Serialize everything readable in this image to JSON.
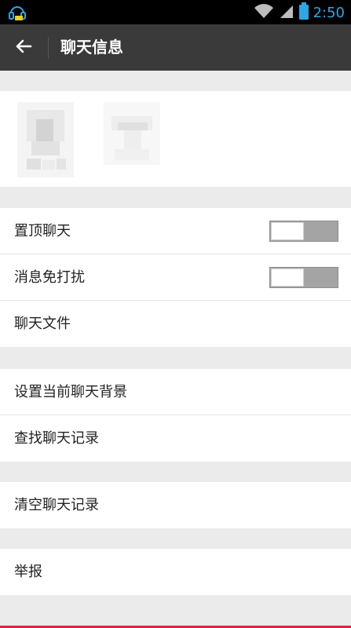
{
  "status_bar": {
    "time": "2:50",
    "left_icon": "headset-notification-icon",
    "wifi_icon": "wifi-icon",
    "signal_icon": "cell-signal-icon",
    "battery_icon": "battery-icon",
    "time_color": "#2fa6e6"
  },
  "header": {
    "back_icon": "arrow-left-icon",
    "title": "聊天信息",
    "background": "#3a3a3a"
  },
  "members": [
    {
      "avatar": "blurred-avatar"
    },
    {
      "avatar": "blurred-avatar"
    }
  ],
  "section1": {
    "items": [
      {
        "label": "置顶聊天",
        "toggle": {
          "on": false
        }
      },
      {
        "label": "消息免打扰",
        "toggle": {
          "on": false
        }
      },
      {
        "label": "聊天文件"
      }
    ]
  },
  "section2": {
    "items": [
      {
        "label": "设置当前聊天背景"
      },
      {
        "label": "查找聊天记录"
      }
    ]
  },
  "section3": {
    "items": [
      {
        "label": "清空聊天记录"
      }
    ]
  },
  "section4": {
    "items": [
      {
        "label": "举报"
      }
    ]
  },
  "colors": {
    "page_bg": "#ebebeb",
    "accent_bottom": "#d9273a"
  }
}
